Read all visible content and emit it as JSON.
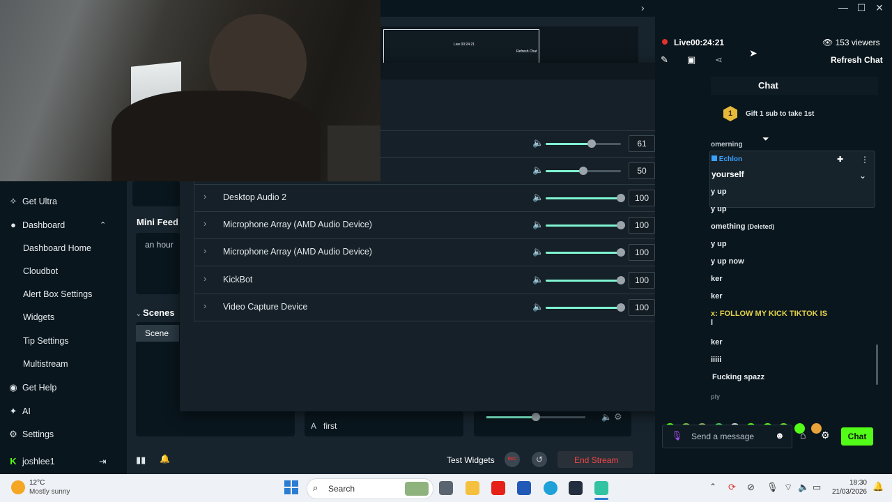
{
  "sidebar": {
    "get_ultra": "Get Ultra",
    "dashboard": "Dashboard",
    "items": [
      "Dashboard Home",
      "Cloudbot",
      "Alert Box Settings",
      "Widgets",
      "Tip Settings",
      "Multistream"
    ],
    "get_help": "Get Help",
    "ai": "AI",
    "settings": "Settings",
    "username": "joshlee1"
  },
  "editor": {
    "mini_feed_title": "Mini Feed",
    "mini_feed_time": "an hour",
    "scenes_title": "Scenes",
    "scene_item": "Scene",
    "source_item": "first",
    "test_widgets": "Test Widgets",
    "rec_label": "REC",
    "end_stream": "End Stream",
    "mini_preview": {
      "live_time": "Live 00:24:21",
      "refresh": "Refresh Chat"
    }
  },
  "mixer": {
    "sources": [
      {
        "name": "",
        "value": "61",
        "level": 0.61
      },
      {
        "name": "",
        "value": "50",
        "level": 0.5
      },
      {
        "name": "Desktop Audio 2",
        "value": "100",
        "level": 1.0
      },
      {
        "name": "Microphone Array (AMD Audio Device)",
        "value": "100",
        "level": 1.0
      },
      {
        "name": "Microphone Array (AMD Audio Device)",
        "value": "100",
        "level": 1.0
      },
      {
        "name": "KickBot",
        "value": "100",
        "level": 1.0
      },
      {
        "name": "Video Capture Device",
        "value": "100",
        "level": 1.0
      }
    ],
    "bottom_mixer_level": 0.5
  },
  "stream": {
    "live_label": "Live",
    "live_time": "00:24:21",
    "viewers": "153 viewers",
    "refresh_chat": "Refresh Chat"
  },
  "chat": {
    "title": "Chat",
    "gift_rank": "1",
    "gift_text": "Gift 1 sub to take 1st",
    "pinned_user": "Echlon",
    "pinned_msg": "yourself",
    "partial_top": "omerning",
    "messages": [
      "y up",
      "y up",
      "omething",
      "y up",
      "y up now",
      "ker",
      "ker",
      "x: FOLLOW MY KICK TIKTOK IS",
      "l",
      "ker",
      "iiiii",
      "Fucking spazz",
      "ply"
    ],
    "deleted_tag": "(Deleted)",
    "input_placeholder": "Send a message",
    "send_button": "Chat"
  },
  "taskbar": {
    "weather_temp": "12°C",
    "weather_desc": "Mostly sunny",
    "search": "Search",
    "time": "18:30",
    "date": "21/03/2026"
  },
  "colors": {
    "accent": "#53fc18",
    "live_red": "#e0322d",
    "danger": "#e03c3c",
    "slider": "#80f5d2"
  }
}
